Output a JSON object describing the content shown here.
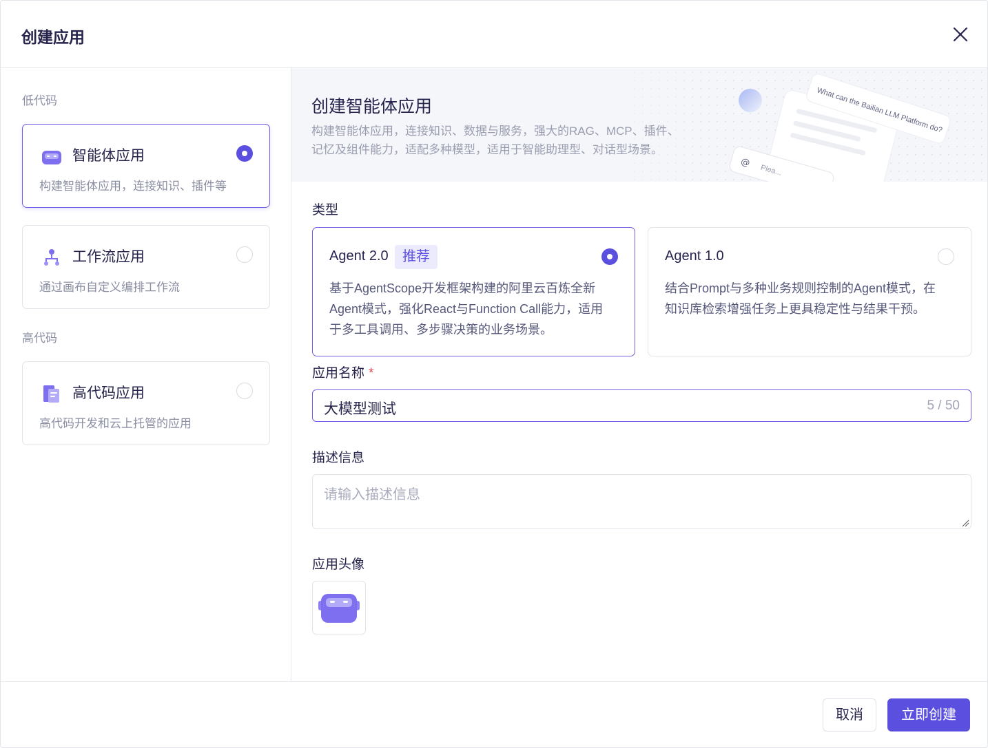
{
  "dialog": {
    "title": "创建应用"
  },
  "sidebar": {
    "low_code_label": "低代码",
    "high_code_label": "高代码",
    "items": [
      {
        "title": "智能体应用",
        "desc": "构建智能体应用，连接知识、插件等",
        "icon": "agent-icon",
        "selected": true
      },
      {
        "title": "工作流应用",
        "desc": "通过画布自定义编排工作流",
        "icon": "workflow-icon",
        "selected": false
      },
      {
        "title": "高代码应用",
        "desc": "高代码开发和云上托管的应用",
        "icon": "code-file-icon",
        "selected": false
      }
    ]
  },
  "banner": {
    "title": "创建智能体应用",
    "desc_line1": "构建智能体应用，连接知识、数据与服务，强大的RAG、MCP、插件、",
    "desc_line2": "记忆及组件能力，适配多种模型，适用于智能助理型、对话型场景。",
    "art_text": "What can the Bailian LLM Platform do?",
    "art_input_text": "Plea..."
  },
  "form": {
    "type_label": "类型",
    "types": [
      {
        "title": "Agent 2.0",
        "badge": "推荐",
        "desc_lines": [
          "基于AgentScope开发框架构建的阿里云百炼全新",
          "Agent模式，强化React与Function Call能力，适用",
          "于多工具调用、多步骤决策的业务场景。"
        ],
        "selected": true
      },
      {
        "title": "Agent 1.0",
        "desc_lines": [
          "结合Prompt与多种业务规则控制的Agent模式，在",
          "知识库检索增强任务上更具稳定性与结果干预。"
        ],
        "selected": false
      }
    ],
    "name_label": "应用名称",
    "required_mark": "*",
    "name_value": "大模型测试",
    "name_count": "5 / 50",
    "desc_label": "描述信息",
    "desc_placeholder": "请输入描述信息",
    "avatar_label": "应用头像"
  },
  "footer": {
    "cancel_label": "取消",
    "create_label": "立即创建"
  },
  "colors": {
    "primary": "#5b4fe0",
    "border": "#e3e4ea",
    "text": "#26244c",
    "muted": "#8b8fa3",
    "required": "#e5484d"
  }
}
